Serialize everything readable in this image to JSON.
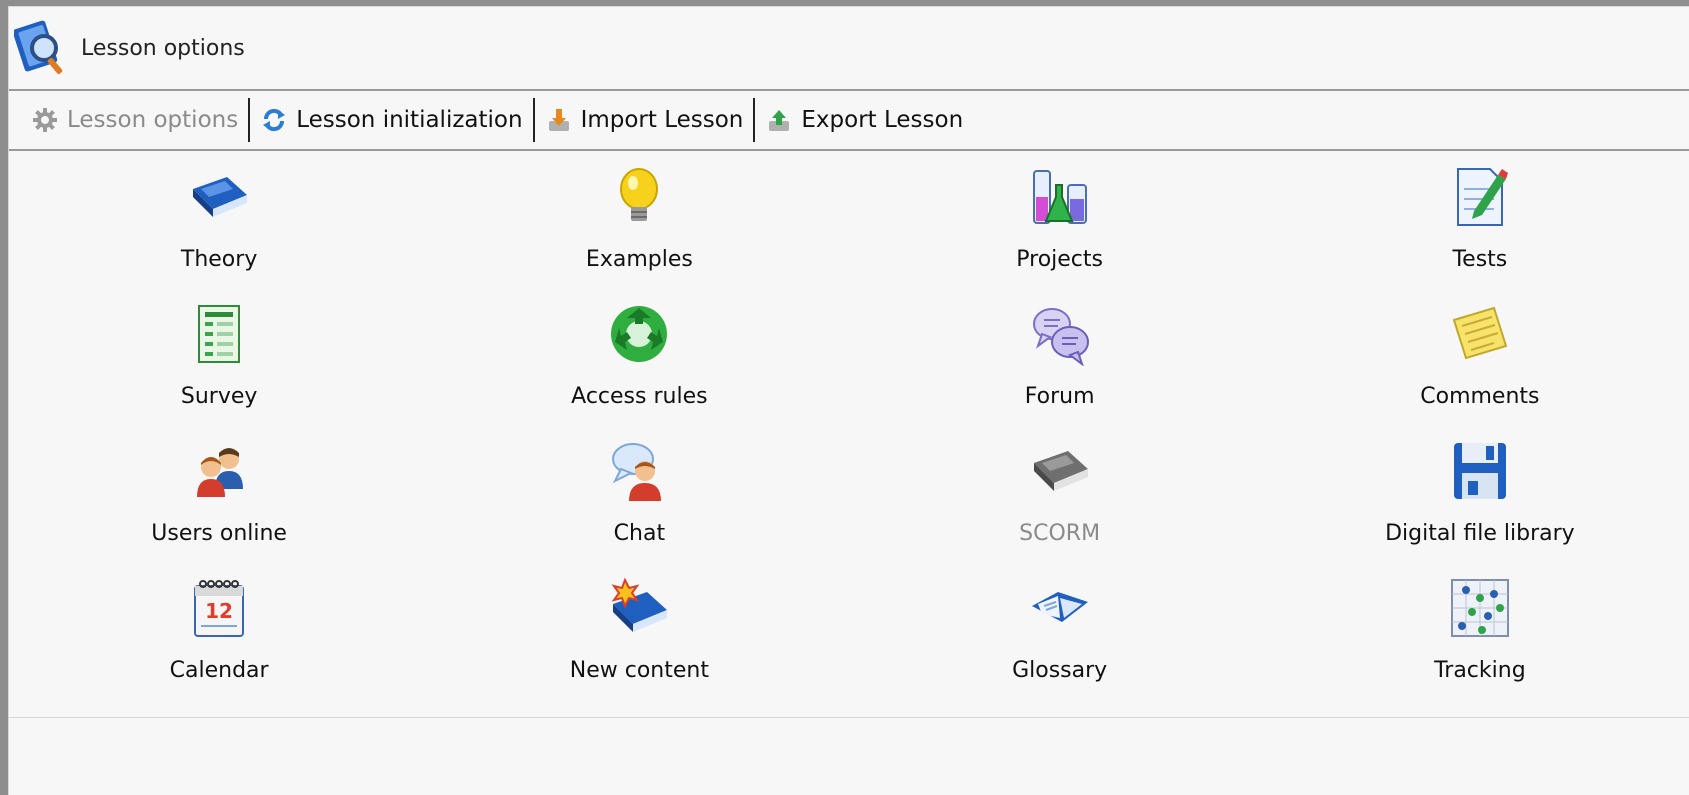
{
  "header": {
    "title": "Lesson options",
    "icon": "lesson-search-icon"
  },
  "toolbar": {
    "items": [
      {
        "label": "Lesson options",
        "icon": "gear-icon",
        "disabled": true
      },
      {
        "label": "Lesson initialization",
        "icon": "refresh-icon"
      },
      {
        "label": "Import Lesson",
        "icon": "import-icon"
      },
      {
        "label": "Export Lesson",
        "icon": "export-icon"
      }
    ]
  },
  "options": [
    {
      "label": "Theory",
      "icon": "book-icon"
    },
    {
      "label": "Examples",
      "icon": "lightbulb-icon"
    },
    {
      "label": "Projects",
      "icon": "lab-flasks-icon"
    },
    {
      "label": "Tests",
      "icon": "test-document-icon"
    },
    {
      "label": "Survey",
      "icon": "survey-form-icon"
    },
    {
      "label": "Access rules",
      "icon": "recycle-arrows-icon"
    },
    {
      "label": "Forum",
      "icon": "speech-bubbles-icon"
    },
    {
      "label": "Comments",
      "icon": "note-icon"
    },
    {
      "label": "Users online",
      "icon": "users-icon"
    },
    {
      "label": "Chat",
      "icon": "chat-user-icon"
    },
    {
      "label": "SCORM",
      "icon": "gray-book-icon",
      "disabled": true
    },
    {
      "label": "Digital file library",
      "icon": "floppy-disk-icon"
    },
    {
      "label": "Calendar",
      "icon": "calendar-icon"
    },
    {
      "label": "New content",
      "icon": "new-book-icon"
    },
    {
      "label": "Glossary",
      "icon": "open-book-icon"
    },
    {
      "label": "Tracking",
      "icon": "tracking-grid-icon"
    }
  ],
  "colors": {
    "accent_blue": "#1f5fbf",
    "disabled_text": "#8a8a8a"
  }
}
